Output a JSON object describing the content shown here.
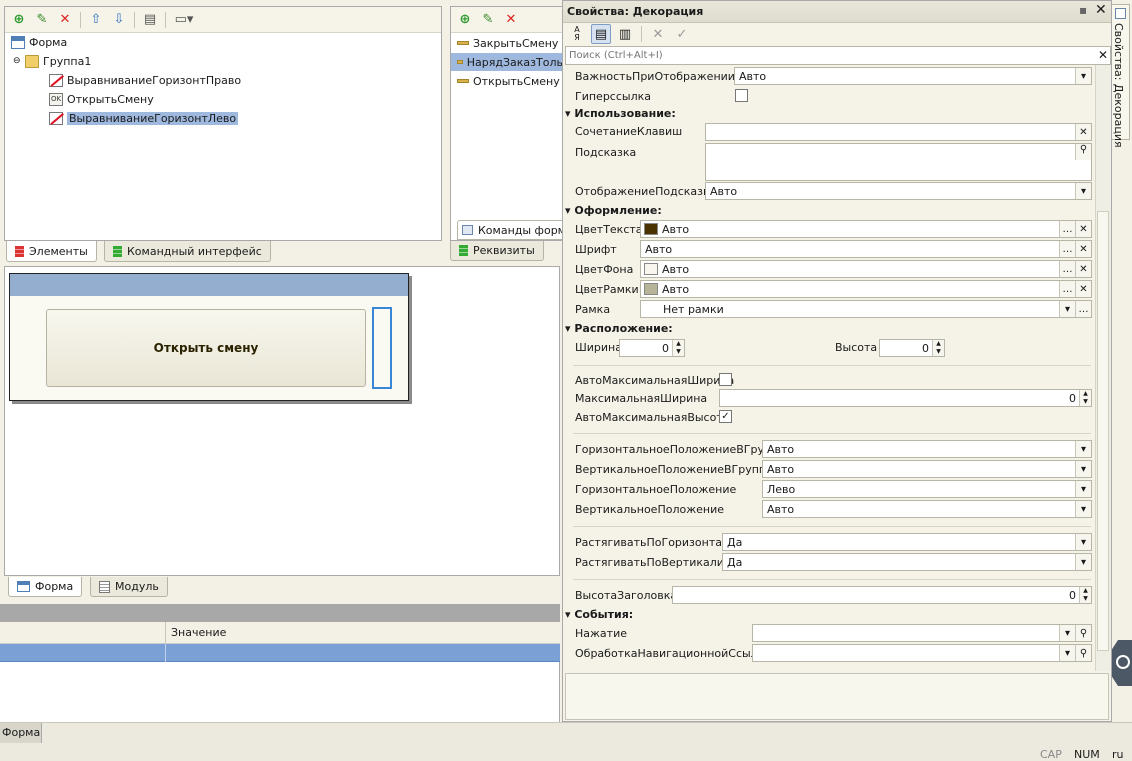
{
  "elements_tree": {
    "root": "Форма",
    "group": "Группа1",
    "items": [
      "ВыравниваниеГоризонтПраво",
      "ОткрытьСмену",
      "ВыравниваниеГоризонтЛево"
    ],
    "selected_index": 2
  },
  "commands_list": {
    "items": [
      "ЗакрытьСмену",
      "НарядЗаказТоль",
      "ОткрытьСмену"
    ],
    "bottom_tab": "Команды форм",
    "tab": "Реквизиты"
  },
  "left_tabs": {
    "elements": "Элементы",
    "command_interface": "Командный интерфейс"
  },
  "preview": {
    "button_label": "Открыть смену"
  },
  "editor_tabs": {
    "form": "Форма",
    "module": "Модуль"
  },
  "bottom_table": {
    "value_header": "Значение"
  },
  "status_bar": {
    "form_label": "Форма",
    "cap": "CAP",
    "num": "NUM",
    "lang": "ru"
  },
  "properties": {
    "title": "Свойства: Декорация",
    "search_placeholder": "Поиск (Ctrl+Alt+I)",
    "side_tab": "Свойства: Декорация",
    "importance_label": "ВажностьПриОтображении",
    "importance_value": "Авто",
    "hyperlink_label": "Гиперссылка",
    "sections": {
      "usage": "Использование:",
      "appearance": "Оформление:",
      "location": "Расположение:",
      "events": "События:"
    },
    "usage": {
      "shortcut_label": "СочетаниеКлавиш",
      "tooltip_label": "Подсказка",
      "tooltip_display_label": "ОтображениеПодсказки",
      "tooltip_display_value": "Авто"
    },
    "appearance": {
      "text_color_label": "ЦветТекста",
      "text_color_value": "Авто",
      "font_label": "Шрифт",
      "font_value": "Авто",
      "bg_color_label": "ЦветФона",
      "bg_color_value": "Авто",
      "border_color_label": "ЦветРамки",
      "border_color_value": "Авто",
      "border_label": "Рамка",
      "border_value": "Нет рамки",
      "text_swatch": "#4a3200",
      "bg_swatch": "#f8f6ee",
      "border_swatch": "#b8b49a"
    },
    "location": {
      "width_label": "Ширина",
      "width_value": "0",
      "height_label": "Высота",
      "height_value": "0",
      "auto_max_width_label": "АвтоМаксимальнаяШирина",
      "max_width_label": "МаксимальнаяШирина",
      "max_width_value": "0",
      "auto_max_height_label": "АвтоМаксимальнаяВысота",
      "hpos_group_label": "ГоризонтальноеПоложениеВГруппе",
      "hpos_group_value": "Авто",
      "vpos_group_label": "ВертикальноеПоложениеВГруппе",
      "vpos_group_value": "Авто",
      "hpos_label": "ГоризонтальноеПоложение",
      "hpos_value": "Лево",
      "vpos_label": "ВертикальноеПоложение",
      "vpos_value": "Авто",
      "stretch_h_label": "РастягиватьПоГоризонтали",
      "stretch_h_value": "Да",
      "stretch_v_label": "РастягиватьПоВертикали",
      "stretch_v_value": "Да",
      "header_height_label": "ВысотаЗаголовка",
      "header_height_value": "0"
    },
    "events": {
      "click_label": "Нажатие",
      "nav_link_label": "ОбработкаНавигационнойСсылки"
    }
  }
}
